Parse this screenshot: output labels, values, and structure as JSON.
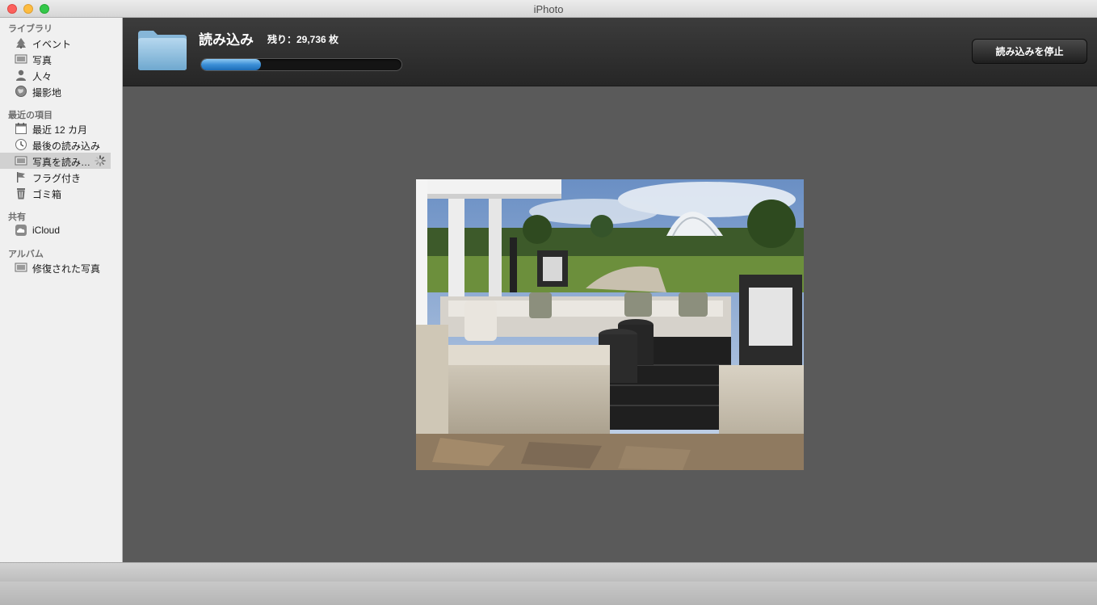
{
  "window": {
    "title": "iPhoto"
  },
  "sidebar": {
    "sections": [
      {
        "title": "ライブラリ",
        "items": [
          {
            "label": "イベント",
            "icon": "events-icon"
          },
          {
            "label": "写真",
            "icon": "photos-icon"
          },
          {
            "label": "人々",
            "icon": "people-icon"
          },
          {
            "label": "撮影地",
            "icon": "places-icon"
          }
        ]
      },
      {
        "title": "最近の項目",
        "items": [
          {
            "label": "最近 12 カ月",
            "icon": "calendar-icon"
          },
          {
            "label": "最後の読み込み",
            "icon": "last-import-icon"
          },
          {
            "label": "写真を読み…",
            "icon": "importing-photos-icon",
            "selected": true,
            "busy": true
          },
          {
            "label": "フラグ付き",
            "icon": "flag-icon"
          },
          {
            "label": "ゴミ箱",
            "icon": "trash-icon"
          }
        ]
      },
      {
        "title": "共有",
        "items": [
          {
            "label": "iCloud",
            "icon": "icloud-icon"
          }
        ]
      },
      {
        "title": "アルバム",
        "items": [
          {
            "label": "修復された写真",
            "icon": "album-icon"
          }
        ]
      }
    ]
  },
  "import": {
    "title": "読み込み",
    "remaining": "残り：29,736 枚",
    "progress": 0.3,
    "stop_label": "読み込みを停止"
  },
  "colors": {
    "accent": "#3b8fd6",
    "content_bg": "#5a5a5a",
    "header_bg": "#2e2e2e",
    "sidebar_bg": "#f0f0f0"
  }
}
